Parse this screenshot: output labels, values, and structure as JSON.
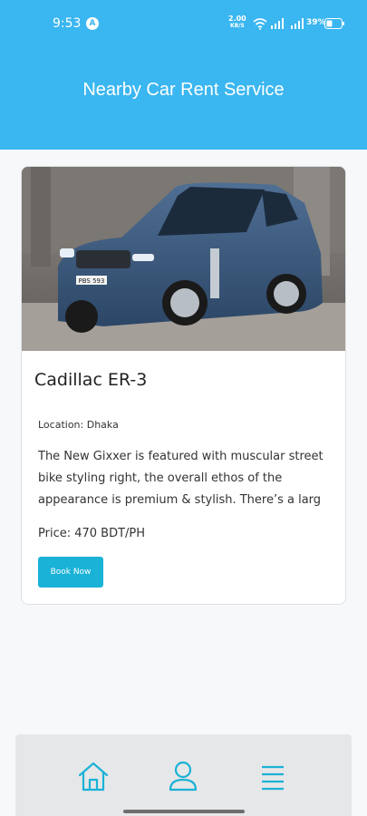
{
  "status_bar": {
    "time": "9:53",
    "net_speed_value": "2.00",
    "net_speed_unit": "KB/S",
    "battery_percent": "39%"
  },
  "header": {
    "title": "Nearby Car Rent Service"
  },
  "listing": {
    "name": "Cadillac ER-3",
    "location": "Location: Dhaka",
    "description": "The New Gixxer is featured with muscular street bike styling right,  the overall ethos of the appearance is premium & stylish.  There’s a larg",
    "price": "Price: 470 BDT/PH",
    "book_label": "Book Now",
    "plate": "PBS 593"
  },
  "colors": {
    "accent": "#3ab6f0",
    "button": "#1ab2d6",
    "nav_icon": "#1ab2d6"
  },
  "nav": {
    "items": [
      {
        "icon": "home-icon"
      },
      {
        "icon": "user-icon"
      },
      {
        "icon": "menu-icon"
      }
    ]
  }
}
